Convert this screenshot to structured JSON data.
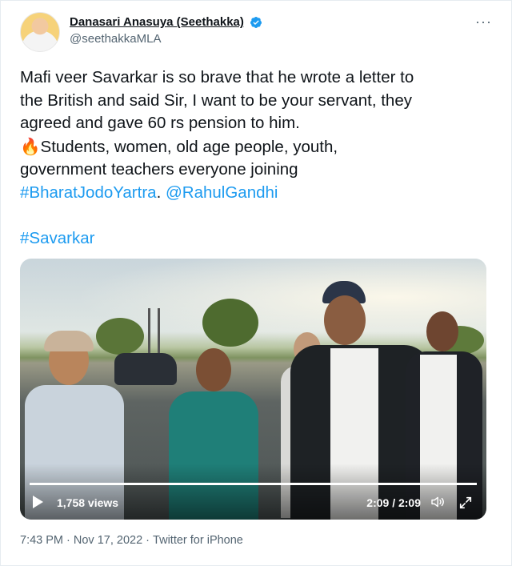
{
  "tweet": {
    "author": {
      "display_name": "Danasari Anasuya (Seethakka)",
      "handle": "@seethakkaMLA",
      "verified": true,
      "avatar_icon": "profile-photo"
    },
    "more_icon": "more-horizontal-icon",
    "text_lines": [
      "Mafi veer Savarkar is so brave that he wrote a letter to",
      "the British and said Sir, I want to be your servant, they",
      "agreed and gave 60 rs pension to him.",
      "Students, women, old age people, youth,",
      "government teachers everyone joining"
    ],
    "emoji": "🔥",
    "hashtag_bharat": "#BharatJodoYartra",
    "separator": ".",
    "mention": "@RahulGandhi",
    "hashtag_savarkar": "#Savarkar",
    "video": {
      "views": "1,758 views",
      "time": "2:09 / 2:09",
      "progress": 1.0,
      "play_icon": "play-icon",
      "volume_icon": "volume-icon",
      "fullscreen_icon": "fullscreen-icon"
    },
    "timestamp": "7:43 PM · Nov 17, 2022",
    "meta_separator": " · ",
    "source": "Twitter for iPhone"
  },
  "colors": {
    "link": "#1d9bf0",
    "text": "#0f1419",
    "muted": "#536471",
    "verified": "#1d9bf0"
  }
}
